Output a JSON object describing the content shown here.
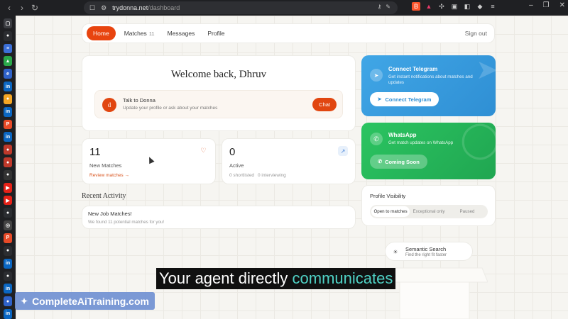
{
  "browser": {
    "url_host": "trydonna.net",
    "url_path": "/dashboard"
  },
  "nav": {
    "items": [
      {
        "label": "Home",
        "active": true
      },
      {
        "label": "Matches",
        "count": "11"
      },
      {
        "label": "Messages"
      },
      {
        "label": "Profile"
      }
    ],
    "signout_label": "Sign out"
  },
  "welcome": {
    "title": "Welcome back, Dhruv",
    "avatar_letter": "d",
    "donna_title": "Talk to Donna",
    "donna_sub": "Update your profile or ask about your matches",
    "chat_label": "Chat"
  },
  "stats": {
    "new_matches_value": "11",
    "new_matches_label": "New Matches",
    "review_link": "Review matches →",
    "active_value": "0",
    "active_label": "Active",
    "shortlisted": "0 shortlisted",
    "interviewing": "0 interviewing"
  },
  "recent": {
    "title": "Recent Activity",
    "item_title": "New Job Matches!",
    "item_sub": "We found 11 potential matches for you!"
  },
  "telegram": {
    "title": "Connect Telegram",
    "sub": "Get instant notifications about matches and updates",
    "button": "Connect Telegram"
  },
  "whatsapp": {
    "title": "WhatsApp",
    "sub": "Get match updates on WhatsApp",
    "button": "Coming Soon"
  },
  "visibility": {
    "title": "Profile Visibility",
    "options": [
      "Open to matches",
      "Exceptional only",
      "Paused"
    ],
    "selected": "Open to matches"
  },
  "semantic": {
    "title": "Semantic Search",
    "sub": "Find the right fit faster"
  },
  "overlay": {
    "caption_pre": "Your agent directly ",
    "caption_hl": "communicates",
    "watermark": "CompleteAiTraining.com"
  },
  "colors": {
    "accent": "#e8440f",
    "telegram": "#2f8fd4",
    "whatsapp": "#20a651"
  },
  "icons": [
    "back-icon",
    "forward-icon",
    "reload-icon",
    "bookmark-icon",
    "telegram-icon",
    "whatsapp-icon",
    "heart-icon",
    "trend-icon",
    "lightbulb-icon"
  ]
}
